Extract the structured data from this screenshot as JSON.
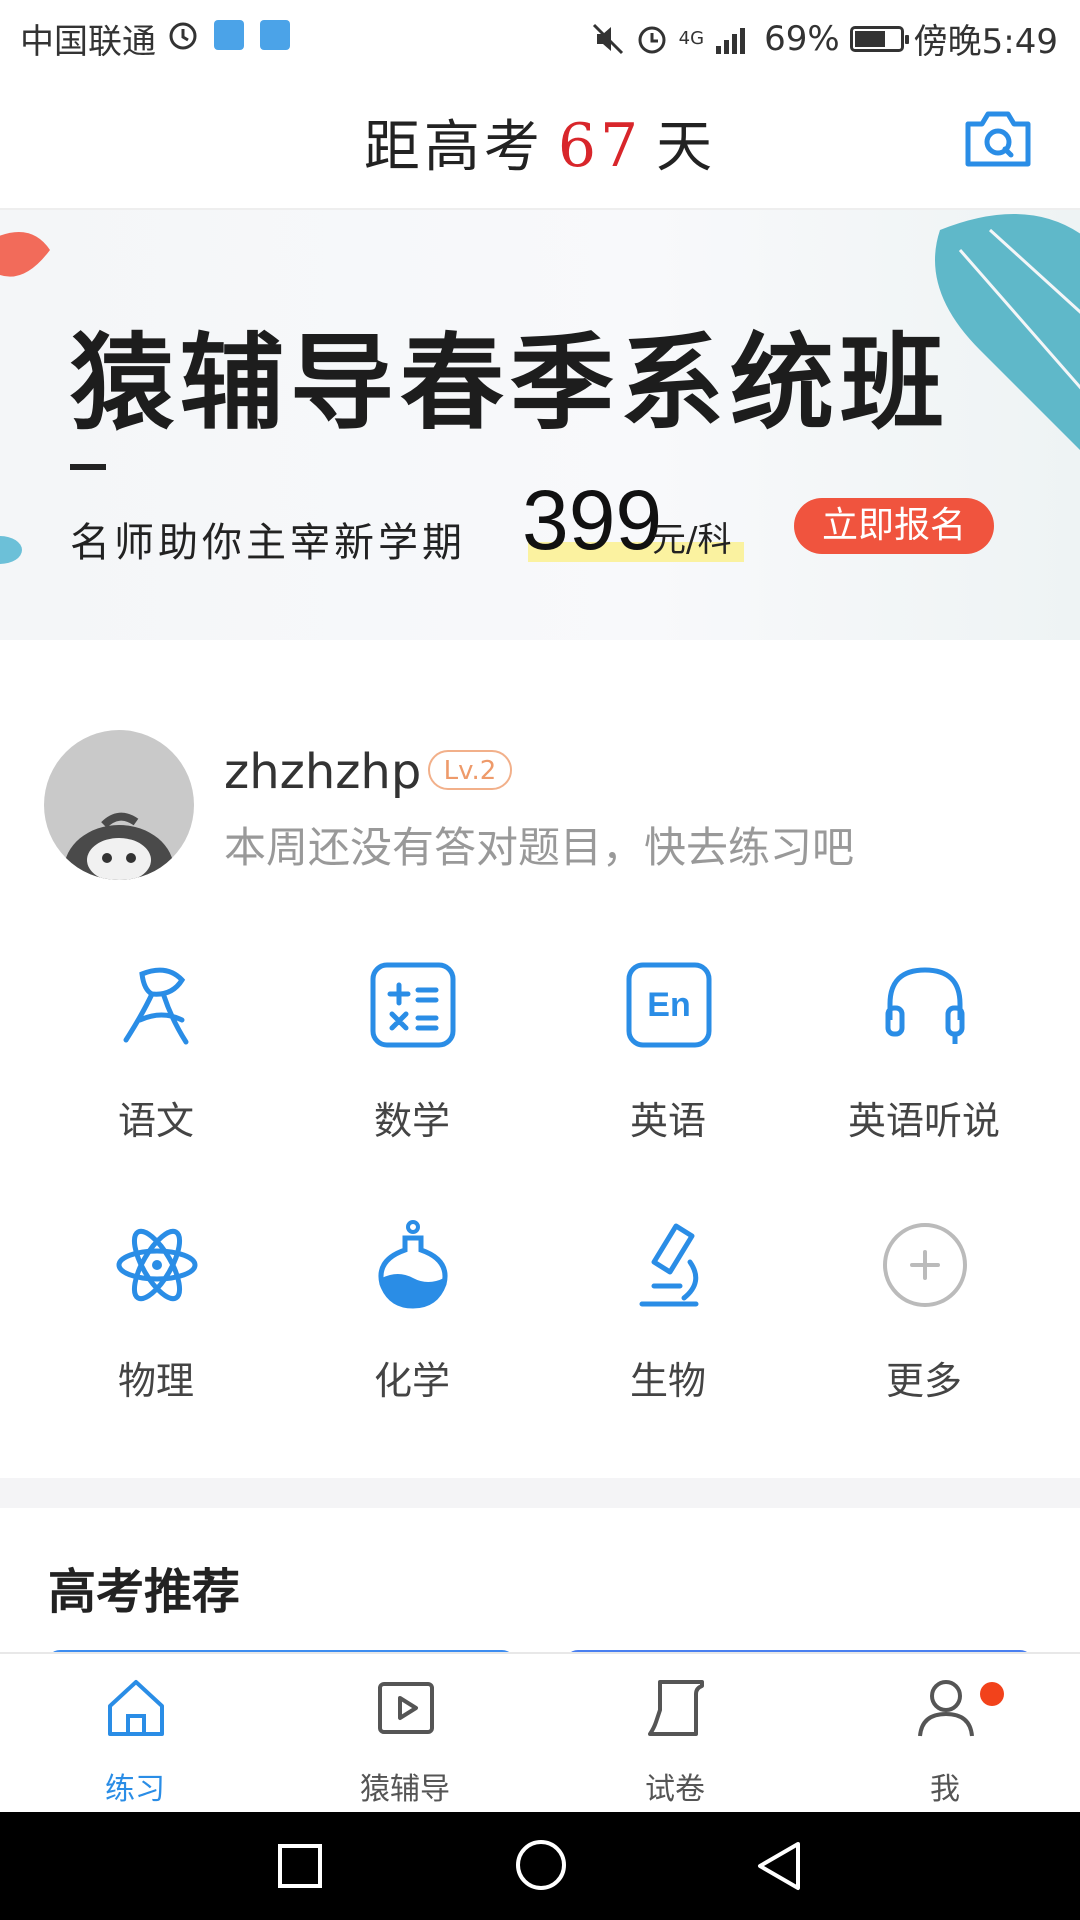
{
  "status_bar": {
    "carrier": "中国联通",
    "battery": "69%",
    "battery_level": 0.69,
    "time": "傍晚5:49",
    "network": "4G"
  },
  "header": {
    "countdown_prefix": "距高考",
    "countdown_days": "67",
    "countdown_suffix": "天"
  },
  "banner": {
    "title": "猿辅导春季系统班",
    "subtitle": "名师助你主宰新学期",
    "price": "399",
    "price_unit": "元/科",
    "cta": "立即报名"
  },
  "profile": {
    "username": "zhzhzhp",
    "level": "Lv.2",
    "hint": "本周还没有答对题目，快去练习吧"
  },
  "subjects": [
    {
      "label": "语文",
      "icon": "chinese-icon"
    },
    {
      "label": "数学",
      "icon": "math-icon"
    },
    {
      "label": "英语",
      "icon": "english-icon"
    },
    {
      "label": "英语听说",
      "icon": "headphones-icon"
    },
    {
      "label": "物理",
      "icon": "atom-icon"
    },
    {
      "label": "化学",
      "icon": "flask-icon"
    },
    {
      "label": "生物",
      "icon": "microscope-icon"
    },
    {
      "label": "更多",
      "icon": "plus-circle-icon"
    }
  ],
  "recommend": {
    "title": "高考推荐"
  },
  "tabs": [
    {
      "label": "练习",
      "icon": "home-icon",
      "active": true
    },
    {
      "label": "猿辅导",
      "icon": "play-icon",
      "active": false
    },
    {
      "label": "试卷",
      "icon": "paper-icon",
      "active": false
    },
    {
      "label": "我",
      "icon": "user-icon",
      "active": false
    }
  ],
  "colors": {
    "accent": "#2a8de6",
    "countdown_number": "#d8262b",
    "cta": "#f0543e",
    "badge": "#f2421b"
  }
}
